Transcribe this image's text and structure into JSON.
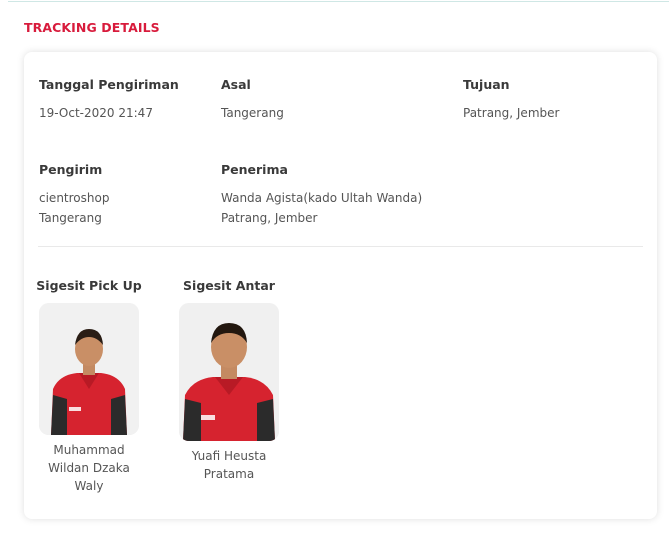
{
  "section_title": "TRACKING DETAILS",
  "shipment": {
    "date_label": "Tanggal Pengiriman",
    "date_value": "19-Oct-2020 21:47",
    "origin_label": "Asal",
    "origin_value": "Tangerang",
    "destination_label": "Tujuan",
    "destination_value": "Patrang, Jember",
    "sender_label": "Pengirim",
    "sender_name": "cientroshop",
    "sender_city": "Tangerang",
    "receiver_label": "Penerima",
    "receiver_name": "Wanda Agista(kado Ultah Wanda)",
    "receiver_city": "Patrang, Jember"
  },
  "couriers": {
    "pickup": {
      "title": "Sigesit Pick Up",
      "name_lines": [
        "Muhammad",
        "Wildan Dzaka",
        "Waly"
      ]
    },
    "delivery": {
      "title": "Sigesit Antar",
      "name_lines": [
        "Yuafi Heusta",
        "Pratama"
      ]
    }
  },
  "colors": {
    "accent": "#d81b3c",
    "uniform_red": "#d6232f",
    "uniform_dark": "#2b2b2b"
  }
}
